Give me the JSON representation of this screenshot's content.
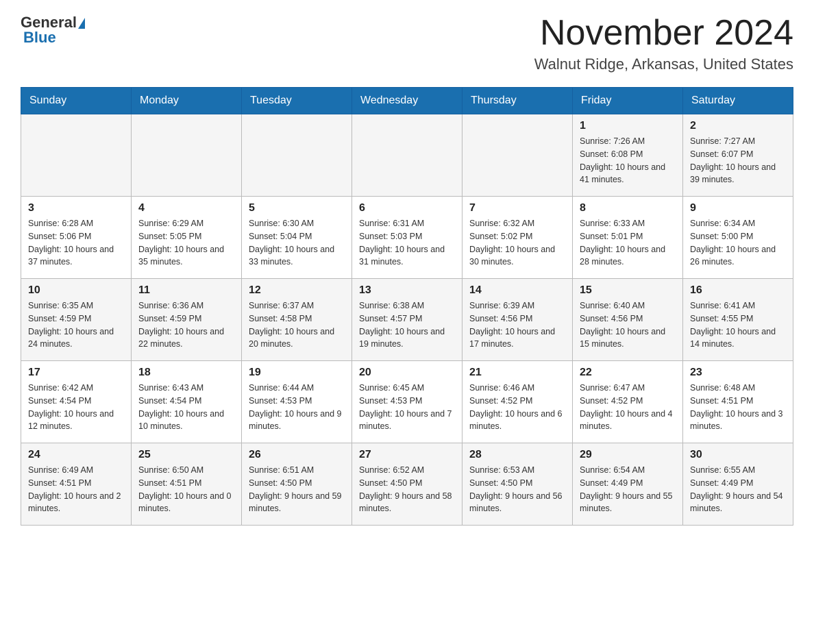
{
  "header": {
    "logo_general": "General",
    "logo_blue": "Blue",
    "month_title": "November 2024",
    "location": "Walnut Ridge, Arkansas, United States"
  },
  "days_of_week": [
    "Sunday",
    "Monday",
    "Tuesday",
    "Wednesday",
    "Thursday",
    "Friday",
    "Saturday"
  ],
  "weeks": [
    [
      {
        "day": "",
        "info": ""
      },
      {
        "day": "",
        "info": ""
      },
      {
        "day": "",
        "info": ""
      },
      {
        "day": "",
        "info": ""
      },
      {
        "day": "",
        "info": ""
      },
      {
        "day": "1",
        "info": "Sunrise: 7:26 AM\nSunset: 6:08 PM\nDaylight: 10 hours and 41 minutes."
      },
      {
        "day": "2",
        "info": "Sunrise: 7:27 AM\nSunset: 6:07 PM\nDaylight: 10 hours and 39 minutes."
      }
    ],
    [
      {
        "day": "3",
        "info": "Sunrise: 6:28 AM\nSunset: 5:06 PM\nDaylight: 10 hours and 37 minutes."
      },
      {
        "day": "4",
        "info": "Sunrise: 6:29 AM\nSunset: 5:05 PM\nDaylight: 10 hours and 35 minutes."
      },
      {
        "day": "5",
        "info": "Sunrise: 6:30 AM\nSunset: 5:04 PM\nDaylight: 10 hours and 33 minutes."
      },
      {
        "day": "6",
        "info": "Sunrise: 6:31 AM\nSunset: 5:03 PM\nDaylight: 10 hours and 31 minutes."
      },
      {
        "day": "7",
        "info": "Sunrise: 6:32 AM\nSunset: 5:02 PM\nDaylight: 10 hours and 30 minutes."
      },
      {
        "day": "8",
        "info": "Sunrise: 6:33 AM\nSunset: 5:01 PM\nDaylight: 10 hours and 28 minutes."
      },
      {
        "day": "9",
        "info": "Sunrise: 6:34 AM\nSunset: 5:00 PM\nDaylight: 10 hours and 26 minutes."
      }
    ],
    [
      {
        "day": "10",
        "info": "Sunrise: 6:35 AM\nSunset: 4:59 PM\nDaylight: 10 hours and 24 minutes."
      },
      {
        "day": "11",
        "info": "Sunrise: 6:36 AM\nSunset: 4:59 PM\nDaylight: 10 hours and 22 minutes."
      },
      {
        "day": "12",
        "info": "Sunrise: 6:37 AM\nSunset: 4:58 PM\nDaylight: 10 hours and 20 minutes."
      },
      {
        "day": "13",
        "info": "Sunrise: 6:38 AM\nSunset: 4:57 PM\nDaylight: 10 hours and 19 minutes."
      },
      {
        "day": "14",
        "info": "Sunrise: 6:39 AM\nSunset: 4:56 PM\nDaylight: 10 hours and 17 minutes."
      },
      {
        "day": "15",
        "info": "Sunrise: 6:40 AM\nSunset: 4:56 PM\nDaylight: 10 hours and 15 minutes."
      },
      {
        "day": "16",
        "info": "Sunrise: 6:41 AM\nSunset: 4:55 PM\nDaylight: 10 hours and 14 minutes."
      }
    ],
    [
      {
        "day": "17",
        "info": "Sunrise: 6:42 AM\nSunset: 4:54 PM\nDaylight: 10 hours and 12 minutes."
      },
      {
        "day": "18",
        "info": "Sunrise: 6:43 AM\nSunset: 4:54 PM\nDaylight: 10 hours and 10 minutes."
      },
      {
        "day": "19",
        "info": "Sunrise: 6:44 AM\nSunset: 4:53 PM\nDaylight: 10 hours and 9 minutes."
      },
      {
        "day": "20",
        "info": "Sunrise: 6:45 AM\nSunset: 4:53 PM\nDaylight: 10 hours and 7 minutes."
      },
      {
        "day": "21",
        "info": "Sunrise: 6:46 AM\nSunset: 4:52 PM\nDaylight: 10 hours and 6 minutes."
      },
      {
        "day": "22",
        "info": "Sunrise: 6:47 AM\nSunset: 4:52 PM\nDaylight: 10 hours and 4 minutes."
      },
      {
        "day": "23",
        "info": "Sunrise: 6:48 AM\nSunset: 4:51 PM\nDaylight: 10 hours and 3 minutes."
      }
    ],
    [
      {
        "day": "24",
        "info": "Sunrise: 6:49 AM\nSunset: 4:51 PM\nDaylight: 10 hours and 2 minutes."
      },
      {
        "day": "25",
        "info": "Sunrise: 6:50 AM\nSunset: 4:51 PM\nDaylight: 10 hours and 0 minutes."
      },
      {
        "day": "26",
        "info": "Sunrise: 6:51 AM\nSunset: 4:50 PM\nDaylight: 9 hours and 59 minutes."
      },
      {
        "day": "27",
        "info": "Sunrise: 6:52 AM\nSunset: 4:50 PM\nDaylight: 9 hours and 58 minutes."
      },
      {
        "day": "28",
        "info": "Sunrise: 6:53 AM\nSunset: 4:50 PM\nDaylight: 9 hours and 56 minutes."
      },
      {
        "day": "29",
        "info": "Sunrise: 6:54 AM\nSunset: 4:49 PM\nDaylight: 9 hours and 55 minutes."
      },
      {
        "day": "30",
        "info": "Sunrise: 6:55 AM\nSunset: 4:49 PM\nDaylight: 9 hours and 54 minutes."
      }
    ]
  ]
}
